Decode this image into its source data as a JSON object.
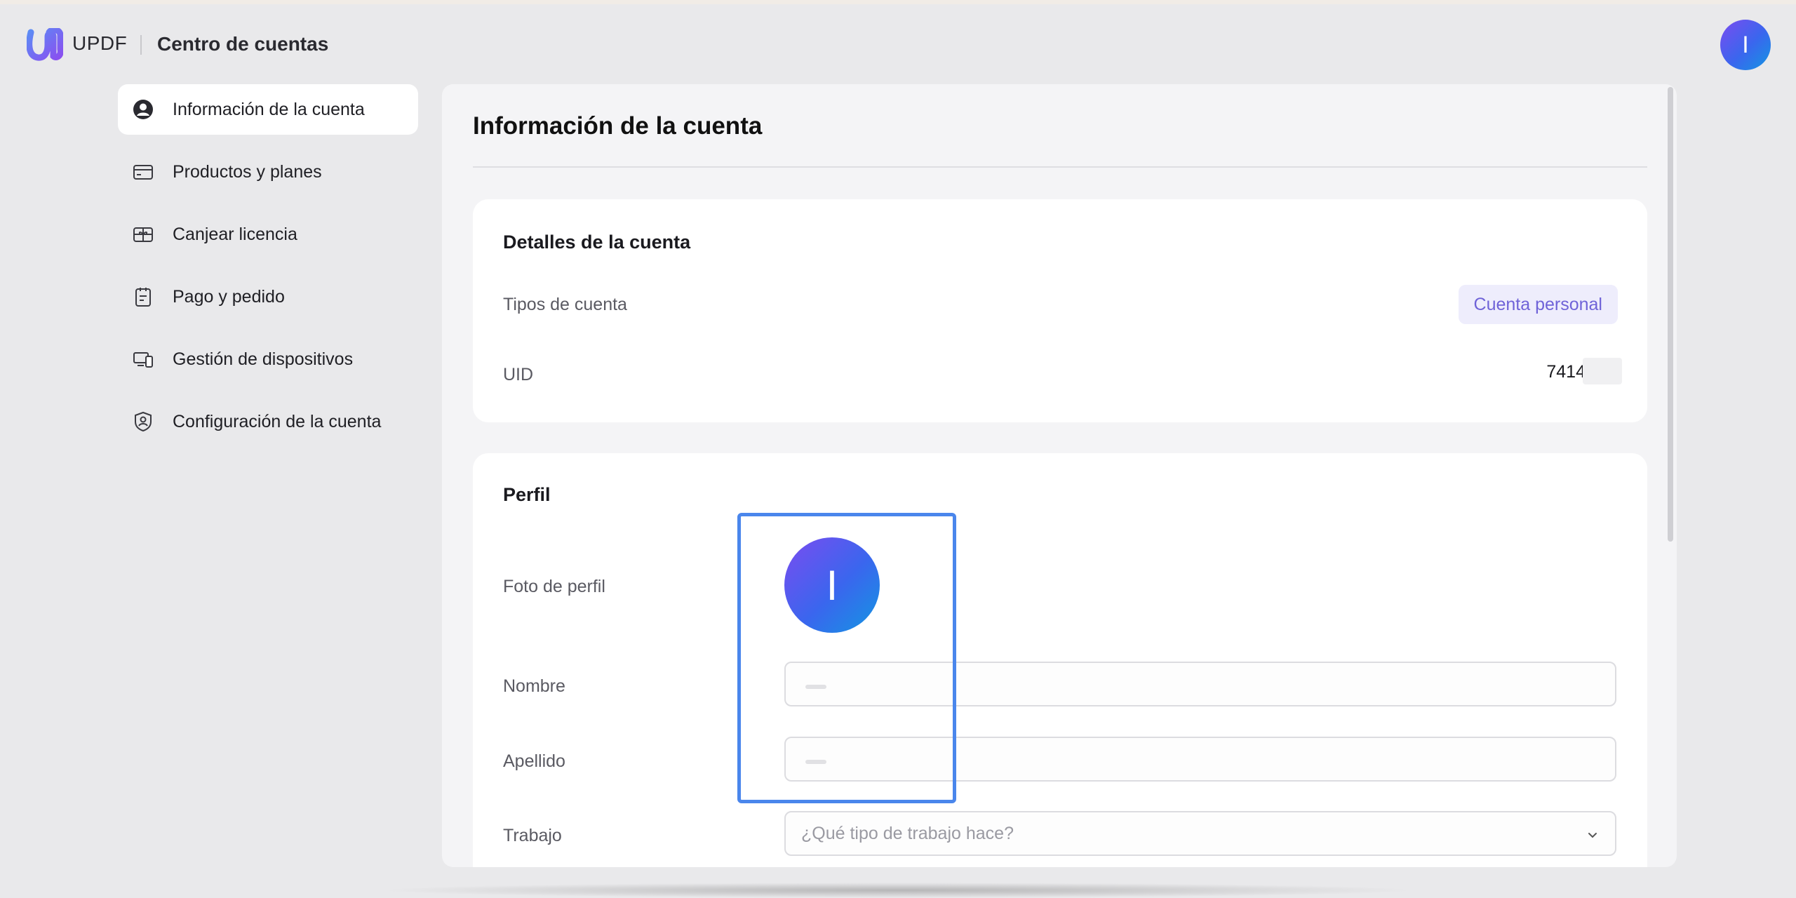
{
  "header": {
    "brand": "UPDF",
    "title": "Centro de cuentas",
    "avatar_initial": "I"
  },
  "sidebar": {
    "items": [
      {
        "label": "Información de la cuenta",
        "icon": "user-circle-icon",
        "active": true
      },
      {
        "label": "Productos y planes",
        "icon": "card-icon",
        "active": false
      },
      {
        "label": "Canjear licencia",
        "icon": "gift-card-icon",
        "active": false
      },
      {
        "label": "Pago y pedido",
        "icon": "clipboard-icon",
        "active": false
      },
      {
        "label": "Gestión de dispositivos",
        "icon": "devices-icon",
        "active": false
      },
      {
        "label": "Configuración de la cuenta",
        "icon": "shield-user-icon",
        "active": false
      }
    ]
  },
  "main": {
    "title": "Información de la cuenta",
    "details": {
      "title": "Detalles de la cuenta",
      "type_label": "Tipos de cuenta",
      "type_value": "Cuenta personal",
      "uid_label": "UID",
      "uid_value": "7414"
    },
    "profile": {
      "title": "Perfil",
      "photo_label": "Foto de perfil",
      "avatar_initial": "I",
      "first_name_label": "Nombre",
      "first_name_value": "",
      "last_name_label": "Apellido",
      "last_name_value": "",
      "job_label": "Trabajo",
      "job_placeholder": "¿Qué tipo de trabajo hace?"
    }
  },
  "colors": {
    "accent": "#6f63d8",
    "avatar_gradient_start": "#7b4cf0",
    "avatar_gradient_end": "#1396e2",
    "highlight": "#4a86ec"
  }
}
